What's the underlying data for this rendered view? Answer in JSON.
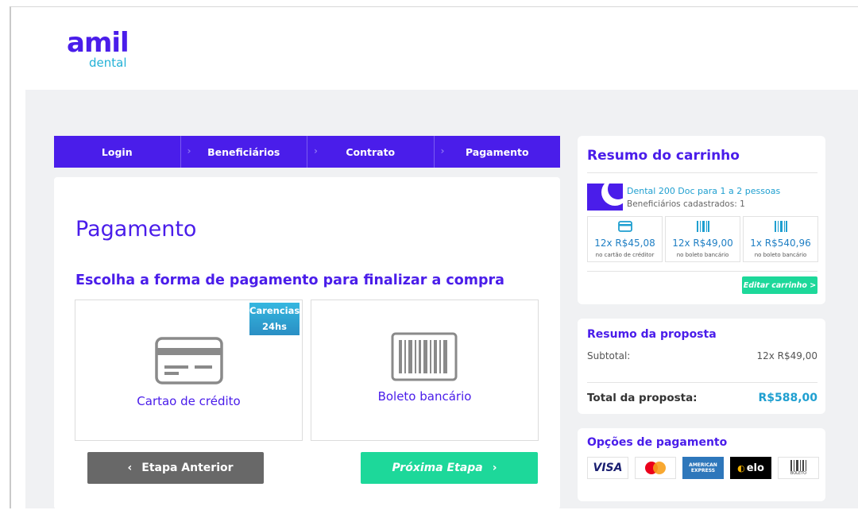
{
  "logo": {
    "brand": "amil",
    "sub": "dental"
  },
  "steps": [
    {
      "label": "Login"
    },
    {
      "label": "Beneficiários"
    },
    {
      "label": "Contrato"
    },
    {
      "label": "Pagamento"
    }
  ],
  "main": {
    "title": "Pagamento",
    "subtitle": "Escolha a forma de pagamento para finalizar a compra",
    "options": {
      "credit": {
        "label": "Cartao de crédito",
        "badge_line1": "Carencias",
        "badge_line2": "24hs"
      },
      "boleto": {
        "label": "Boleto bancário"
      }
    },
    "prev_button": "Etapa Anterior",
    "next_button": "Próxima Etapa"
  },
  "cart": {
    "title": "Resumo do carrinho",
    "plan_name": "Dental 200 Doc para 1 a 2 pessoas",
    "beneficiaries": "Beneficiários cadastrados: 1",
    "prices": [
      {
        "amount": "12x R$45,08",
        "note": "no cartão de créditor",
        "icon": "credit-card-icon"
      },
      {
        "amount": "12x R$49,00",
        "note": "no boleto bancário",
        "icon": "barcode-icon"
      },
      {
        "amount": "1x R$540,96",
        "note": "no boleto bancário",
        "icon": "barcode-icon"
      }
    ],
    "edit_button": "Editar carrinho >"
  },
  "proposal": {
    "title": "Resumo da proposta",
    "subtotal_label": "Subtotal:",
    "subtotal_value": "12x R$49,00",
    "total_label": "Total da proposta:",
    "total_value": "R$588,00"
  },
  "payment_options": {
    "title": "Opções de pagamento",
    "brands": {
      "visa": "VISA",
      "amex_line1": "AMERICAN",
      "amex_line2": "EXPRESS",
      "elo": "elo",
      "boleto": "BOLETO"
    }
  },
  "colors": {
    "brand_purple": "#4a1dea",
    "accent_green": "#1dd89a",
    "accent_blue": "#1f9fd0",
    "button_gray": "#686868"
  }
}
